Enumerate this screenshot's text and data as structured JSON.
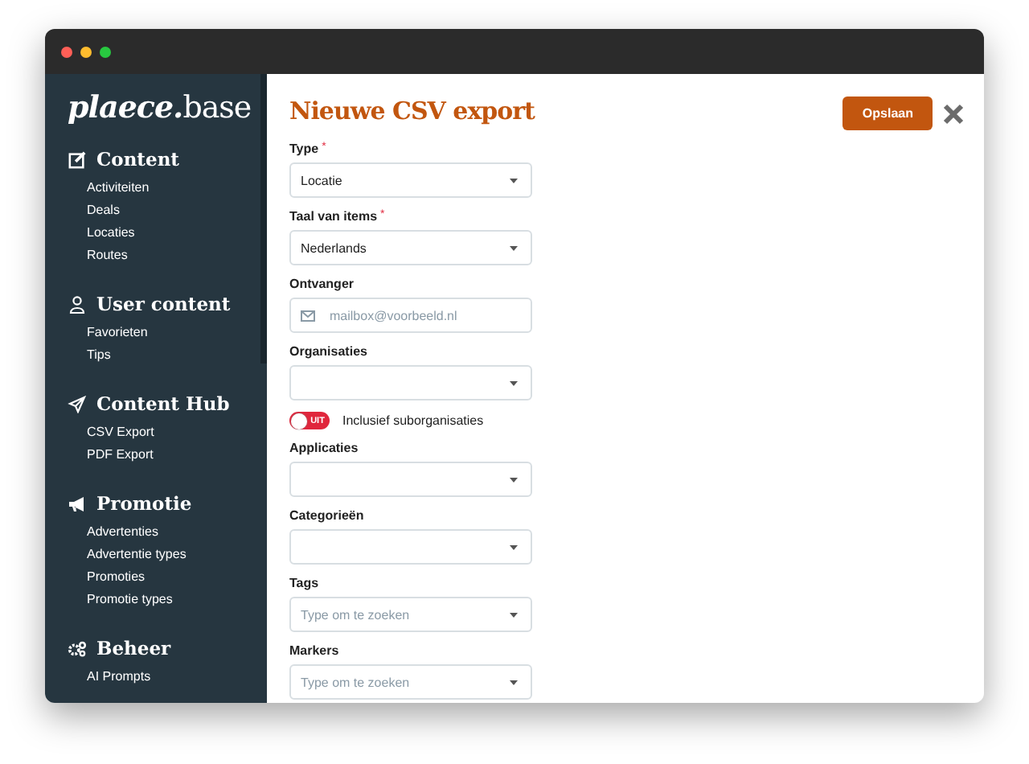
{
  "logo": {
    "bold": "plaece.",
    "light": "base"
  },
  "sidebar": {
    "sections": [
      {
        "title": "Content",
        "items": [
          "Activiteiten",
          "Deals",
          "Locaties",
          "Routes"
        ]
      },
      {
        "title": "User content",
        "items": [
          "Favorieten",
          "Tips"
        ]
      },
      {
        "title": "Content Hub",
        "items": [
          "CSV Export",
          "PDF Export"
        ]
      },
      {
        "title": "Promotie",
        "items": [
          "Advertenties",
          "Advertentie types",
          "Promoties",
          "Promotie types"
        ]
      },
      {
        "title": "Beheer",
        "items": [
          "AI Prompts"
        ]
      }
    ]
  },
  "page": {
    "title": "Nieuwe CSV export",
    "save_button": "Opslaan"
  },
  "fields": [
    {
      "kind": "select",
      "label": "Type",
      "required_mark": "*",
      "value": "Locatie"
    },
    {
      "kind": "select",
      "label": "Taal van items",
      "required_mark": "*",
      "value": "Nederlands"
    },
    {
      "kind": "email",
      "label": "Ontvanger",
      "placeholder": "mailbox@voorbeeld.nl"
    },
    {
      "kind": "select",
      "label": "Organisaties"
    },
    {
      "kind": "toggle",
      "label": "Inclusief suborganisaties",
      "on": false,
      "state_text": "UIT"
    },
    {
      "kind": "select",
      "label": "Applicaties"
    },
    {
      "kind": "select",
      "label": "Categorieën"
    },
    {
      "kind": "select",
      "label": "Tags",
      "placeholder": "Type om te zoeken"
    },
    {
      "kind": "select",
      "label": "Markers",
      "placeholder": "Type om te zoeken"
    }
  ]
}
